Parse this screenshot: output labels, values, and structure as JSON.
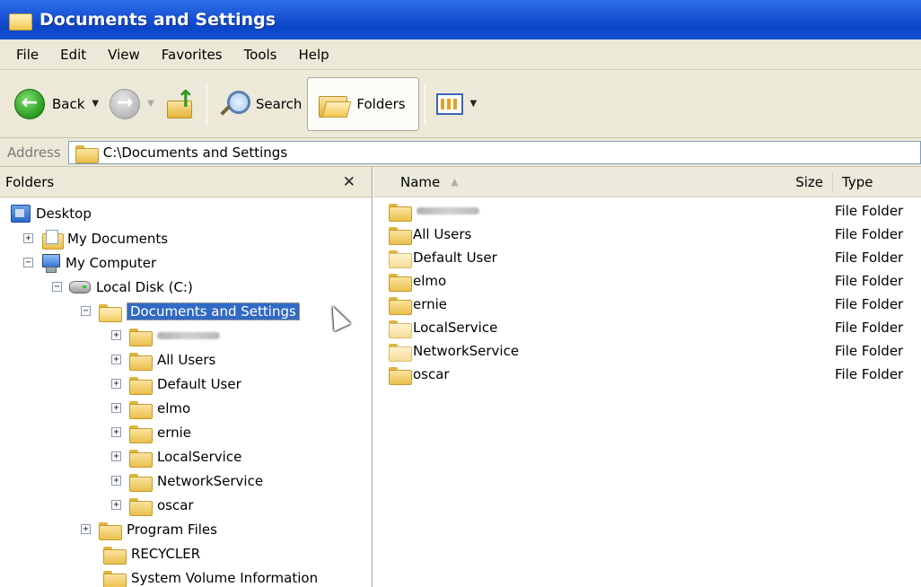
{
  "window": {
    "title": "Documents and Settings"
  },
  "menu": [
    "File",
    "Edit",
    "View",
    "Favorites",
    "Tools",
    "Help"
  ],
  "toolbar": {
    "back_label": "Back",
    "search_label": "Search",
    "folders_label": "Folders"
  },
  "address": {
    "label": "Address",
    "value": "C:\\Documents and Settings"
  },
  "folders_pane": {
    "title": "Folders",
    "tree": [
      {
        "label": "Desktop",
        "icon": "desktop-icon"
      },
      {
        "label": "My Documents",
        "icon": "my-documents-icon"
      },
      {
        "label": "My Computer",
        "icon": "computer-icon"
      },
      {
        "label": "Local Disk (C:)",
        "icon": "disk-icon"
      },
      {
        "label": "Documents and Settings",
        "icon": "folder-open-icon"
      },
      {
        "label": "",
        "icon": "folder-icon"
      },
      {
        "label": "All Users",
        "icon": "folder-icon"
      },
      {
        "label": "Default User",
        "icon": "folder-icon"
      },
      {
        "label": "elmo",
        "icon": "folder-icon"
      },
      {
        "label": "ernie",
        "icon": "folder-icon"
      },
      {
        "label": "LocalService",
        "icon": "folder-icon"
      },
      {
        "label": "NetworkService",
        "icon": "folder-icon"
      },
      {
        "label": "oscar",
        "icon": "folder-icon"
      },
      {
        "label": "Program Files",
        "icon": "folder-icon"
      },
      {
        "label": "RECYCLER",
        "icon": "folder-icon"
      },
      {
        "label": "System Volume Information",
        "icon": "folder-icon"
      }
    ]
  },
  "list": {
    "columns": {
      "name": "Name",
      "size": "Size",
      "type": "Type"
    },
    "rows": [
      {
        "name": "",
        "type": "File Folder"
      },
      {
        "name": "All Users",
        "type": "File Folder"
      },
      {
        "name": "Default User",
        "type": "File Folder"
      },
      {
        "name": "elmo",
        "type": "File Folder"
      },
      {
        "name": "ernie",
        "type": "File Folder"
      },
      {
        "name": "LocalService",
        "type": "File Folder"
      },
      {
        "name": "NetworkService",
        "type": "File Folder"
      },
      {
        "name": "oscar",
        "type": "File Folder"
      }
    ]
  }
}
